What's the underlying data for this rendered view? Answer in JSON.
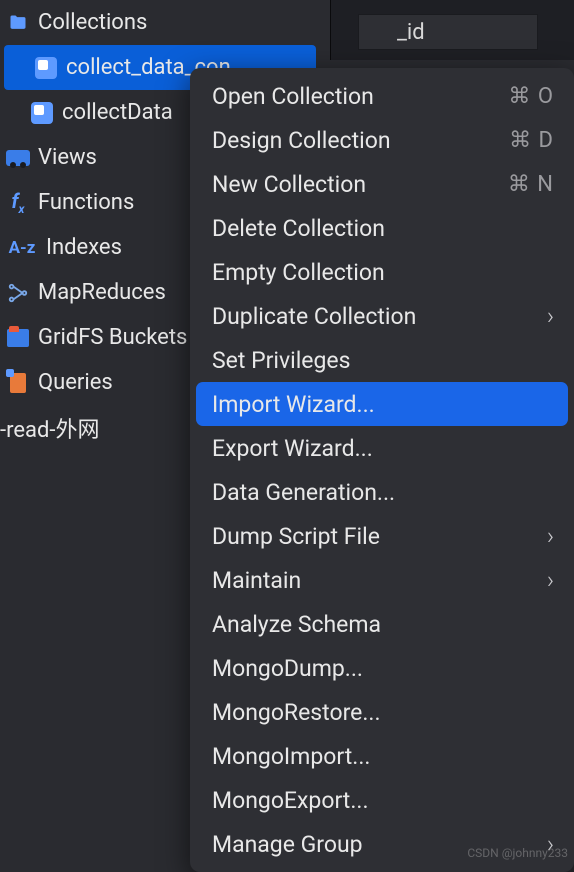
{
  "sidebar": {
    "groups": [
      {
        "label": "Collections",
        "icon": "folder"
      },
      {
        "label": "collect_data_con",
        "icon": "collection",
        "level": 1,
        "selected": true
      },
      {
        "label": "collectData",
        "icon": "collection",
        "level": 1
      },
      {
        "label": "Views",
        "icon": "views"
      },
      {
        "label": "Functions",
        "icon": "fx"
      },
      {
        "label": "Indexes",
        "icon": "az"
      },
      {
        "label": "MapReduces",
        "icon": "mapreduce"
      },
      {
        "label": "GridFS Buckets",
        "icon": "gridfs"
      },
      {
        "label": "Queries",
        "icon": "queries"
      },
      {
        "label": "-read-外网",
        "icon": "none",
        "unindented": true
      }
    ]
  },
  "column_header": "_id",
  "context_menu": {
    "items": [
      {
        "label": "Open Collection",
        "shortcut": "⌘ O"
      },
      {
        "label": "Design Collection",
        "shortcut": "⌘ D"
      },
      {
        "label": "New Collection",
        "shortcut": "⌘ N"
      },
      {
        "label": "Delete Collection"
      },
      {
        "label": "Empty Collection"
      },
      {
        "label": "Duplicate Collection",
        "submenu": true
      },
      {
        "label": "Set Privileges"
      },
      {
        "label": "Import Wizard...",
        "highlighted": true
      },
      {
        "label": "Export Wizard..."
      },
      {
        "label": "Data Generation..."
      },
      {
        "label": "Dump Script File",
        "submenu": true
      },
      {
        "label": "Maintain",
        "submenu": true
      },
      {
        "label": "Analyze Schema"
      },
      {
        "label": "MongoDump..."
      },
      {
        "label": "MongoRestore..."
      },
      {
        "label": "MongoImport..."
      },
      {
        "label": "MongoExport..."
      },
      {
        "label": "Manage Group",
        "submenu": true
      }
    ]
  },
  "watermark": "CSDN @johnny233"
}
